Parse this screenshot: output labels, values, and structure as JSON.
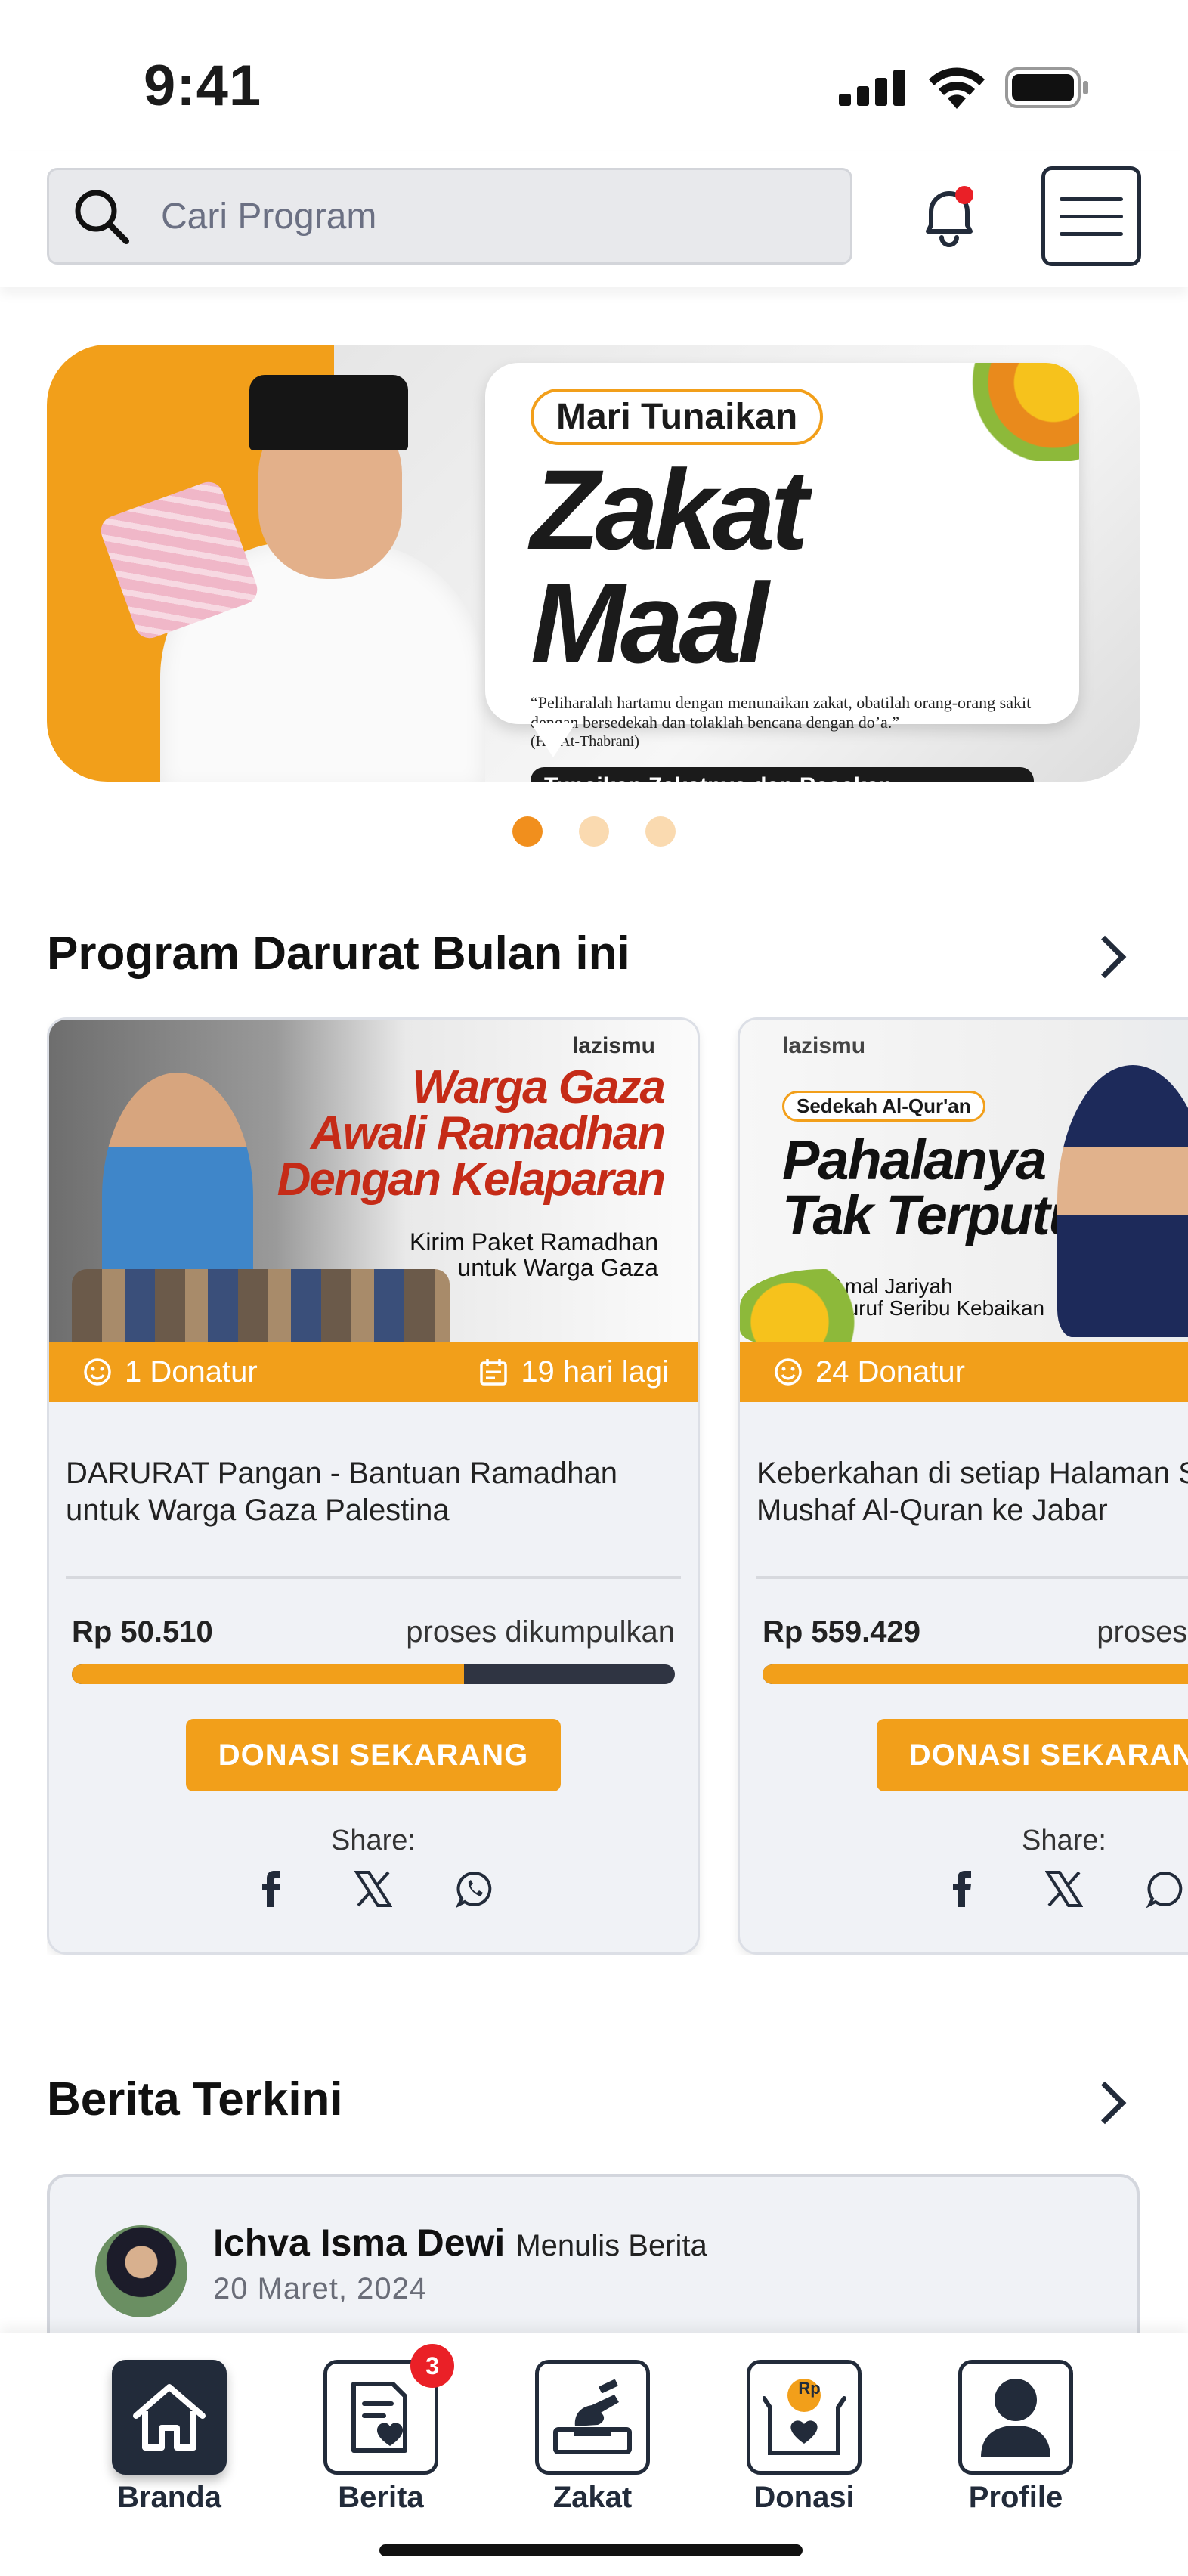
{
  "status_bar": {
    "time": "9:41"
  },
  "header": {
    "search_placeholder": "Cari Program",
    "bell_has_notification": true
  },
  "banner": {
    "pill": "Mari Tunaikan",
    "title": "Zakat Maal",
    "quote": "“Peliharalah hartamu dengan menunaikan zakat, obatilah orang-orang sakit dengan bersedekah dan tolaklah bencana dengan do’a.”",
    "quote_source": "(HR At-Thabrani)",
    "cta": "Tunaikan Zakatnya dan Rasakan Ketenangannya",
    "dots_count": 3,
    "active_dot": 0
  },
  "program_section": {
    "title": "Program Darurat Bulan ini",
    "cards": [
      {
        "image_title": [
          "Warga Gaza",
          "Awali Ramadhan",
          "Dengan Kelaparan"
        ],
        "image_sub": [
          "Kirim Paket Ramadhan",
          "untuk Warga Gaza"
        ],
        "image_logo": "lazismu",
        "donors": "1 Donatur",
        "days_left": "19 hari lagi",
        "title": "DARURAT Pangan - Bantuan Ramadhan untuk Warga Gaza Palestina",
        "amount": "Rp 50.510",
        "status": "proses dikumpulkan",
        "progress": 0.65,
        "button": "DONASI SEKARANG",
        "share_label": "Share:"
      },
      {
        "image_tag": "Sedekah Al-Qur'an",
        "image_title": [
          "Pahalanya",
          "Tak Terputus"
        ],
        "image_sub": [
          "Raih Amal Jariyah",
          "Satu Huruf Seribu Kebaikan"
        ],
        "image_logo": "lazismu",
        "donors": "24 Donatur",
        "days_left": "",
        "title": "Keberkahan di setiap Halaman Sedekah Mushaf Al-Quran ke Jabar",
        "amount": "Rp 559.429",
        "status": "proses dikumpulkan",
        "progress": 0.95,
        "button": "DONASI SEKARANG",
        "share_label": "Share:"
      }
    ]
  },
  "news_section": {
    "title": "Berita Terkini",
    "items": [
      {
        "author": "Ichva Isma Dewi",
        "action": "Menulis Berita",
        "date": "20 Maret, 2024"
      }
    ]
  },
  "bottom_nav": {
    "items": [
      {
        "label": "Branda",
        "icon": "home-icon",
        "active": true
      },
      {
        "label": "Berita",
        "icon": "news-heart-icon",
        "badge": "3"
      },
      {
        "label": "Zakat",
        "icon": "zakat-hand-icon"
      },
      {
        "label": "Donasi",
        "icon": "donation-box-icon",
        "coin_text": "Rp"
      },
      {
        "label": "Profile",
        "icon": "user-icon"
      }
    ]
  },
  "colors": {
    "accent": "#f29f1a",
    "dark": "#222b3a",
    "badge": "#ea2027"
  }
}
